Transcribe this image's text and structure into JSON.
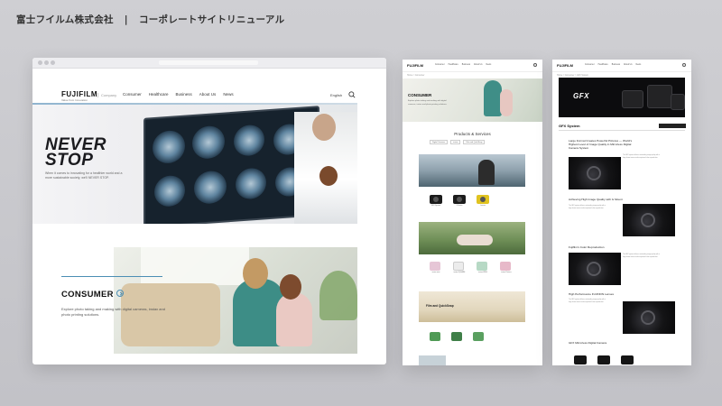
{
  "header": {
    "company": "富士フイルム株式会社",
    "separator": "|",
    "project": "コーポレートサイトリニューアル"
  },
  "main_site": {
    "logo": "FUJIFILM",
    "logo_tagline": "Value from Innovation",
    "company_label": "Company",
    "nav": [
      "Consumer",
      "Healthcare",
      "Business",
      "About Us",
      "News"
    ],
    "lang": "English",
    "hero_title_line1": "NEVER",
    "hero_title_line2": "STOP",
    "hero_text": "When it comes to innovating for a healthier world and a more sustainable society, we'll NEVER STOP.",
    "consumer_title": "CONSUMER",
    "consumer_text": "Explore photo taking and making with digital cameras, instax and photo printing solutions."
  },
  "consumer_page": {
    "logo": "FUJIFILM",
    "nav": [
      "Consumer",
      "Healthcare",
      "Business",
      "About Us",
      "News"
    ],
    "breadcrumb": "Home > Consumer",
    "hero_label": "CONSUMER",
    "hero_text": "Explore photo taking and making with digital cameras, instax and photo printing solutions.",
    "section_title": "Products & Services",
    "tabs": [
      "Digital Cameras",
      "instax",
      "Film and QuickSnap"
    ],
    "camera_labels": [
      "GFX System",
      "X Series",
      "Lenses"
    ],
    "instax_labels": [
      "instax mini",
      "instax SQUARE",
      "instax WIDE",
      "instax Printers"
    ],
    "film_label": "Film and QuickSnap"
  },
  "gfx_page": {
    "logo": "FUJIFILM",
    "nav": [
      "Consumer",
      "Healthcare",
      "Business",
      "About Us",
      "News"
    ],
    "breadcrumb": "Home > Consumer > GFX System",
    "banner_logo": "GFX",
    "section_title": "GFX System",
    "features": [
      {
        "title": "Large Format Creates Powerful Pictures — World's Highest Level of Image Quality in Mirrorless Digital Camera System"
      },
      {
        "title": "Achieving High Image Quality with G Mount"
      },
      {
        "title": "Fujifilm's Color Reproduction"
      },
      {
        "title": "High Performance FUJINON Lenses"
      },
      {
        "title": "GFX Mirrorless Digital Camera"
      }
    ],
    "feature_text": "The GFX system delivers outstanding image quality with a large format sensor and exceptional color reproduction."
  }
}
